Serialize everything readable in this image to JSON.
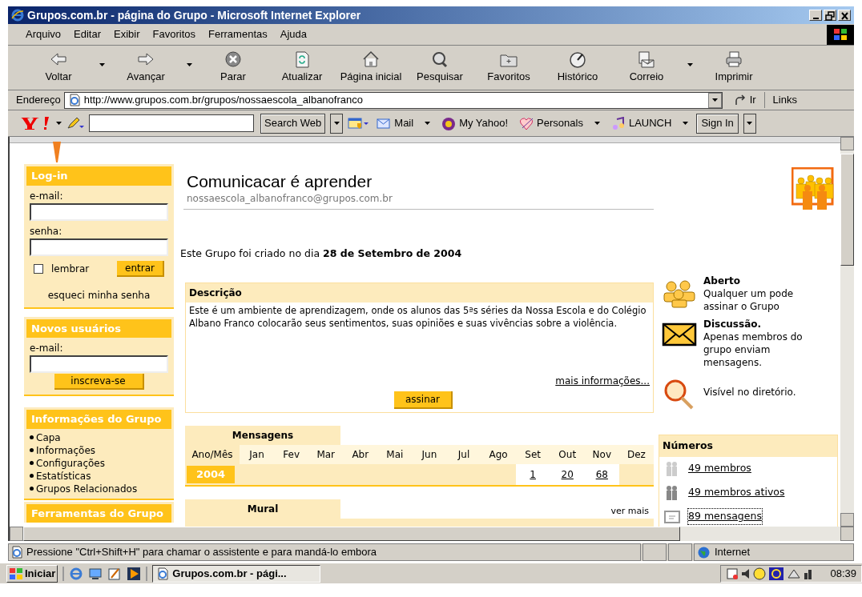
{
  "window": {
    "title": "Grupos.com.br - página do Grupo - Microsoft Internet Explorer"
  },
  "menu": [
    "Arquivo",
    "Editar",
    "Exibir",
    "Favoritos",
    "Ferramentas",
    "Ajuda"
  ],
  "toolbar": [
    {
      "label": "Voltar",
      "dropdown": true
    },
    {
      "label": "Avançar",
      "dropdown": true
    },
    {
      "label": "Parar",
      "dropdown": false
    },
    {
      "label": "Atualizar",
      "dropdown": false
    },
    {
      "label": "Página inicial",
      "dropdown": false
    },
    {
      "label": "Pesquisar",
      "dropdown": false
    },
    {
      "label": "Favoritos",
      "dropdown": false
    },
    {
      "label": "Histórico",
      "dropdown": false
    },
    {
      "label": "Correio",
      "dropdown": true
    },
    {
      "label": "Imprimir",
      "dropdown": false
    }
  ],
  "address": {
    "label": "Endereço",
    "url": "http://www.grupos.com.br/grupos/nossaescola_albanofranco",
    "go": "Ir",
    "links": "Links"
  },
  "yahoo_bar": {
    "search_button": "Search Web",
    "items": [
      {
        "label": "Mail",
        "dropdown": true
      },
      {
        "label": "My Yahoo!",
        "dropdown": false
      },
      {
        "label": "Personals",
        "dropdown": true
      },
      {
        "label": "LAUNCH",
        "dropdown": true
      }
    ],
    "sign_in": "Sign In"
  },
  "login": {
    "title": "Log-in",
    "email_label": "e-mail:",
    "password_label": "senha:",
    "remember": {
      "label": "lembrar",
      "checked": false
    },
    "submit": "entrar",
    "forgot": "esqueci minha senha"
  },
  "signup": {
    "title": "Novos usuários",
    "email_label": "e-mail:",
    "submit": "inscreva-se"
  },
  "info": {
    "title": "Informações do Grupo",
    "items": [
      "Capa",
      "Informações",
      "Configurações",
      "Estatísticas",
      "Grupos Relacionados"
    ]
  },
  "tools": {
    "title": "Ferramentas do Grupo"
  },
  "group": {
    "name": "Comunicacar é aprender",
    "email": "nossaescola_albanofranco@grupos.com.br",
    "created": "Este Grupo foi criado no dia **28 de Setembro de 2004**"
  },
  "description": {
    "title": "Descrição",
    "text": "Este é um ambiente de aprendizagem, onde os alunos das 5ªs séries da Nossa Escola e do Colégio Albano Franco colocarão seus sentimentos, suas opiniões e suas vivências sobre a violência.",
    "more_link": "mais informações...",
    "subscribe": "assinar"
  },
  "features": [
    {
      "title": "Aberto",
      "text": "Qualquer um pode assinar o Grupo"
    },
    {
      "title": "Discussão.",
      "text": "Apenas membros do grupo enviam mensagens."
    },
    {
      "text": "Visível no diretório."
    }
  ],
  "messages": {
    "title": "Mensagens",
    "header": "Ano/Mês",
    "year": "2004",
    "months": [
      {
        "label": "Jan"
      },
      {
        "label": "Fev"
      },
      {
        "label": "Mar"
      },
      {
        "label": "Abr"
      },
      {
        "label": "Mai"
      },
      {
        "label": "Jun"
      },
      {
        "label": "Jul"
      },
      {
        "label": "Ago"
      },
      {
        "label": "Set",
        "count": "1"
      },
      {
        "label": "Out",
        "count": "20"
      },
      {
        "label": "Nov",
        "count": "68"
      },
      {
        "label": "Dez"
      }
    ]
  },
  "mural": {
    "title": "Mural",
    "more": "ver mais"
  },
  "numbers": {
    "title": "Números",
    "items": [
      {
        "text": "49 membros",
        "focused": false
      },
      {
        "text": "49 membros ativos",
        "focused": false
      },
      {
        "text": "89 mensagens",
        "focused": true
      }
    ]
  },
  "status_bar": {
    "text": "Pressione \"Ctrl+Shift+H\" para chamar o assistente e para mandá-lo embora",
    "zone": "Internet"
  },
  "taskbar": {
    "start": "Iniciar",
    "task": "Grupos.com.br - pági...",
    "clock": "08:39"
  }
}
